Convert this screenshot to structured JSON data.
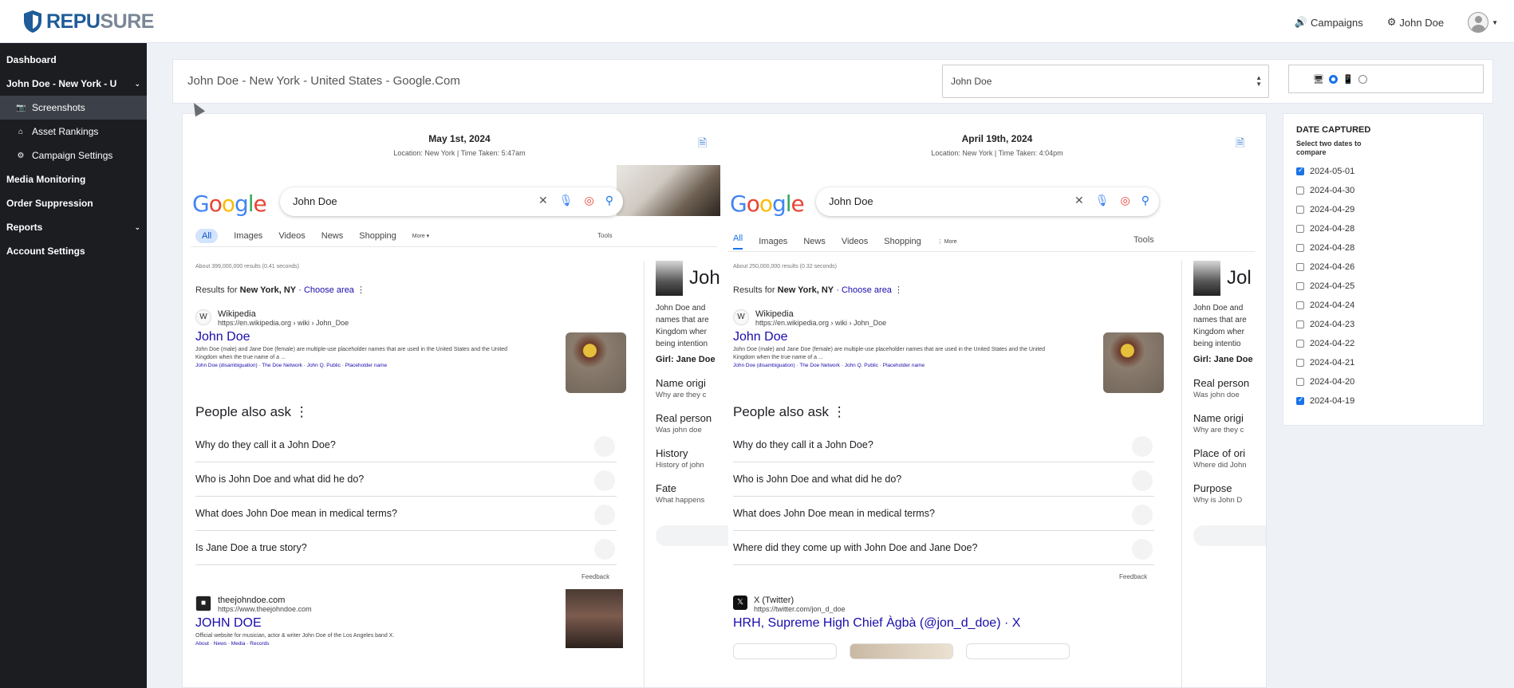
{
  "brand": {
    "name_a": "REPU",
    "name_b": "SURE"
  },
  "topbar": {
    "campaigns_label": "Campaigns",
    "user_label": "John Doe",
    "campaigns_icon": "speaker-icon",
    "user_icon": "gear-icon"
  },
  "sidebar": {
    "items": [
      {
        "label": "Dashboard"
      },
      {
        "label": "John Doe - New York - U"
      },
      {
        "label": "Screenshots",
        "icon": "camera-icon"
      },
      {
        "label": "Asset Rankings",
        "icon": "home-icon"
      },
      {
        "label": "Campaign Settings",
        "icon": "gear-icon"
      },
      {
        "label": "Media Monitoring"
      },
      {
        "label": "Order Suppression"
      },
      {
        "label": "Reports"
      },
      {
        "label": "Account Settings"
      }
    ]
  },
  "header": {
    "title": "John Doe - New York - United States - Google.Com",
    "select_value": "John Doe"
  },
  "left": {
    "date": "May 1st, 2024",
    "location": "Location: New York | Time Taken: 5:47am",
    "query": "John Doe",
    "tabs": [
      "All",
      "Images",
      "Videos",
      "News",
      "Shopping",
      "More ▾"
    ],
    "tools": "Tools",
    "about": "About 399,000,000 results (0.41 seconds)",
    "results_for": "Results for",
    "results_for_loc": "New York, NY",
    "choose_area": "· Choose area",
    "r1_site": "Wikipedia",
    "r1_url": "https://en.wikipedia.org › wiki › John_Doe",
    "r1_title": "John Doe",
    "r1_snippet": "John Doe (male) and Jane Doe (female) are multiple-use placeholder names that are used in the United States and the United Kingdom when the true name of a ...",
    "r1_links": "John Doe (disambiguation) · The Doe Network · John Q. Public · Placeholder name",
    "paa_title": "People also ask",
    "paa": [
      "Why do they call it a John Doe?",
      "Who is John Doe and what did he do?",
      "What does John Doe mean in medical terms?",
      "Is Jane Doe a true story?"
    ],
    "feedback": "Feedback",
    "r2_site": "theejohndoe.com",
    "r2_url": "https://www.theejohndoe.com",
    "r2_title": "JOHN DOE",
    "r2_snippet": "Official website for musician, actor & writer John Doe of the Los Angeles band X.",
    "r2_links": "About · News · Media · Records",
    "kp_name": "Joh",
    "kp_desc": [
      "John Doe and",
      "names that are",
      "Kingdom wher",
      "being intention"
    ],
    "kp_girl": "Girl: Jane Doe",
    "kp_sections": [
      {
        "t": "Name origi",
        "s": "Why are they c"
      },
      {
        "t": "Real person",
        "s": "Was john doe"
      },
      {
        "t": "History",
        "s": "History of john"
      },
      {
        "t": "Fate",
        "s": "What happens"
      }
    ]
  },
  "right": {
    "date": "April 19th, 2024",
    "location": "Location: New York | Time Taken: 4:04pm",
    "query": "John Doe",
    "tabs": [
      "All",
      "Images",
      "News",
      "Videos",
      "Shopping",
      "⋮ More"
    ],
    "tools": "Tools",
    "about": "About 250,000,000 results (0.32 seconds)",
    "results_for": "Results for",
    "results_for_loc": "New York, NY",
    "choose_area": "· Choose area",
    "r1_site": "Wikipedia",
    "r1_url": "https://en.wikipedia.org › wiki › John_Doe",
    "r1_title": "John Doe",
    "r1_snippet": "John Doe (male) and Jane Doe (female) are multiple-use placeholder names that are used in the United States and the United Kingdom when the true name of a ...",
    "r1_links": "John Doe (disambiguation) · The Doe Network · John Q. Public · Placeholder name",
    "paa_title": "People also ask",
    "paa": [
      "Why do they call it a John Doe?",
      "Who is John Doe and what did he do?",
      "What does John Doe mean in medical terms?",
      "Where did they come up with John Doe and Jane Doe?"
    ],
    "feedback": "Feedback",
    "r2_site": "X (Twitter)",
    "r2_url": "https://twitter.com/jon_d_doe",
    "r2_title": "HRH, Supreme High Chief Àgbà (@jon_d_doe) · X",
    "kp_name": "Jol",
    "kp_desc": [
      "John Doe and",
      "names that are",
      "Kingdom wher",
      "being intentio"
    ],
    "kp_girl": "Girl: Jane Doe",
    "kp_sections": [
      {
        "t": "Real person",
        "s": "Was john doe"
      },
      {
        "t": "Name origi",
        "s": "Why are they c"
      },
      {
        "t": "Place of ori",
        "s": "Where did John"
      },
      {
        "t": "Purpose",
        "s": "Why is John D"
      }
    ]
  },
  "dates_panel": {
    "title": "DATE CAPTURED",
    "subtitle": "Select two dates to compare",
    "dates": [
      {
        "d": "2024-05-01",
        "checked": true
      },
      {
        "d": "2024-04-30",
        "checked": false
      },
      {
        "d": "2024-04-29",
        "checked": false
      },
      {
        "d": "2024-04-28",
        "checked": false
      },
      {
        "d": "2024-04-28",
        "checked": false
      },
      {
        "d": "2024-04-26",
        "checked": false
      },
      {
        "d": "2024-04-25",
        "checked": false
      },
      {
        "d": "2024-04-24",
        "checked": false
      },
      {
        "d": "2024-04-23",
        "checked": false
      },
      {
        "d": "2024-04-22",
        "checked": false
      },
      {
        "d": "2024-04-21",
        "checked": false
      },
      {
        "d": "2024-04-20",
        "checked": false
      },
      {
        "d": "2024-04-19",
        "checked": true
      }
    ]
  },
  "colors": {
    "sidebar": "#1b1d21",
    "sidebar_active": "#3c4048",
    "brand_blue": "#1f5c99",
    "link": "#1a0dab"
  }
}
